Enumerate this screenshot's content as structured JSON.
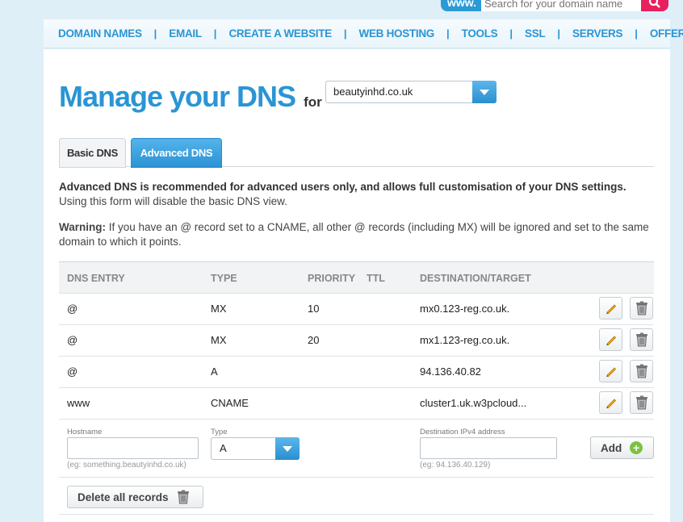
{
  "search": {
    "www_label": "www.",
    "placeholder": "Search for your domain name"
  },
  "nav": [
    "DOMAIN NAMES",
    "EMAIL",
    "CREATE A WEBSITE",
    "WEB HOSTING",
    "TOOLS",
    "SSL",
    "SERVERS",
    "OFFERS"
  ],
  "nav_separator": "|",
  "header": {
    "title": "Manage your DNS",
    "for_label": "for",
    "domain": "beautyinhd.co.uk"
  },
  "tabs": {
    "basic": "Basic DNS",
    "advanced": "Advanced DNS",
    "active": "advanced"
  },
  "info": {
    "bold": "Advanced DNS is recommended for advanced users only, and allows full customisation of your DNS settings.",
    "rest": "Using this form will disable the basic DNS view."
  },
  "warning": {
    "label": "Warning:",
    "text": "If you have an @ record set to a CNAME, all other @ records (including MX) will be ignored and set to the same domain to which it points."
  },
  "table": {
    "headers": {
      "entry": "DNS ENTRY",
      "type": "TYPE",
      "priority": "PRIORITY",
      "ttl": "TTL",
      "destination": "DESTINATION/TARGET"
    },
    "rows": [
      {
        "entry": "@",
        "type": "MX",
        "priority": "10",
        "ttl": "",
        "destination": "mx0.123-reg.co.uk."
      },
      {
        "entry": "@",
        "type": "MX",
        "priority": "20",
        "ttl": "",
        "destination": "mx1.123-reg.co.uk."
      },
      {
        "entry": "@",
        "type": "A",
        "priority": "",
        "ttl": "",
        "destination": "94.136.40.82"
      },
      {
        "entry": "www",
        "type": "CNAME",
        "priority": "",
        "ttl": "",
        "destination": "cluster1.uk.w3pcloud..."
      }
    ]
  },
  "add_form": {
    "hostname_label": "Hostname",
    "hostname_hint": "(eg: something.beautyinhd.co.uk)",
    "type_label": "Type",
    "type_value": "A",
    "dest_label": "Destination IPv4 address",
    "dest_hint": "(eg: 94.136.40.129)",
    "add_label": "Add"
  },
  "delete_all_label": "Delete all records",
  "colors": {
    "accent": "#2a95d4",
    "search_button": "#e8205e",
    "add_icon": "#7cc242"
  }
}
